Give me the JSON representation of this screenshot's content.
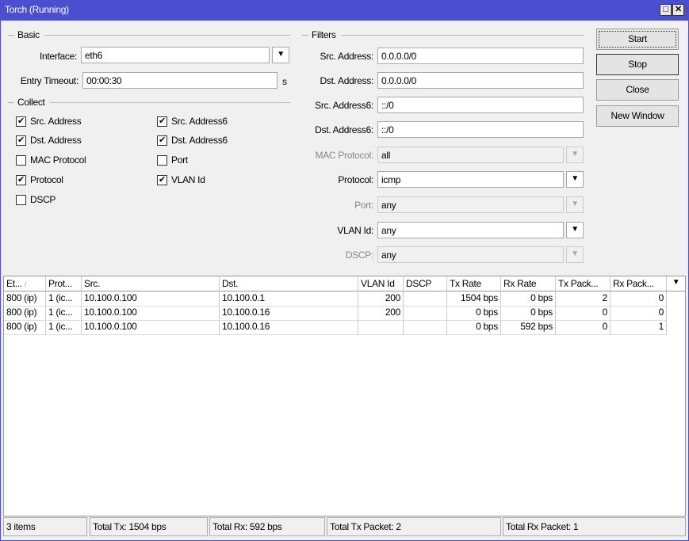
{
  "window": {
    "title": "Torch (Running)",
    "maximize_icon": "□",
    "close_icon": "✕"
  },
  "basic": {
    "group": "Basic",
    "interface_label": "Interface:",
    "interface_value": "eth6",
    "timeout_label": "Entry Timeout:",
    "timeout_value": "00:00:30",
    "timeout_unit": "s"
  },
  "collect": {
    "group": "Collect",
    "items": [
      {
        "label": "Src. Address",
        "checked": true
      },
      {
        "label": "Dst. Address",
        "checked": true
      },
      {
        "label": "MAC Protocol",
        "checked": false
      },
      {
        "label": "Protocol",
        "checked": true
      },
      {
        "label": "DSCP",
        "checked": false
      },
      {
        "label": "Src. Address6",
        "checked": true
      },
      {
        "label": "Dst. Address6",
        "checked": true
      },
      {
        "label": "Port",
        "checked": false
      },
      {
        "label": "VLAN Id",
        "checked": true
      }
    ]
  },
  "filters": {
    "group": "Filters",
    "fields": [
      {
        "label": "Src. Address:",
        "value": "0.0.0.0/0"
      },
      {
        "label": "Dst. Address:",
        "value": "0.0.0.0/0"
      },
      {
        "label": "Src. Address6:",
        "value": "::/0"
      },
      {
        "label": "Dst. Address6:",
        "value": "::/0"
      },
      {
        "label": "MAC Protocol:",
        "value": "all"
      },
      {
        "label": "Protocol:",
        "value": "icmp"
      },
      {
        "label": "Port:",
        "value": "any"
      },
      {
        "label": "VLAN Id:",
        "value": "any"
      },
      {
        "label": "DSCP:",
        "value": "any"
      }
    ]
  },
  "buttons": {
    "start": "Start",
    "stop": "Stop",
    "close": "Close",
    "new_window": "New Window"
  },
  "table": {
    "columns": [
      "Et...",
      "Prot...",
      "Src.",
      "Dst.",
      "VLAN Id",
      "DSCP",
      "Tx Rate",
      "Rx Rate",
      "Tx Pack...",
      "Rx Pack..."
    ],
    "sort_indicator": "/",
    "menu_icon": "▼",
    "rows": [
      [
        "800 (ip)",
        "1 (ic...",
        "10.100.0.100",
        "10.100.0.1",
        "200",
        "",
        "1504 bps",
        "0 bps",
        "2",
        "0"
      ],
      [
        "800 (ip)",
        "1 (ic...",
        "10.100.0.100",
        "10.100.0.16",
        "200",
        "",
        "0 bps",
        "0 bps",
        "0",
        "0"
      ],
      [
        "800 (ip)",
        "1 (ic...",
        "10.100.0.100",
        "10.100.0.16",
        "",
        "",
        "0 bps",
        "592 bps",
        "0",
        "1"
      ]
    ]
  },
  "status": {
    "items": "3 items",
    "total_tx": "Total Tx: 1504 bps",
    "total_rx": "Total Rx: 592 bps",
    "total_tx_packet": "Total Tx Packet: 2",
    "total_rx_packet": "Total Rx Packet: 1"
  }
}
